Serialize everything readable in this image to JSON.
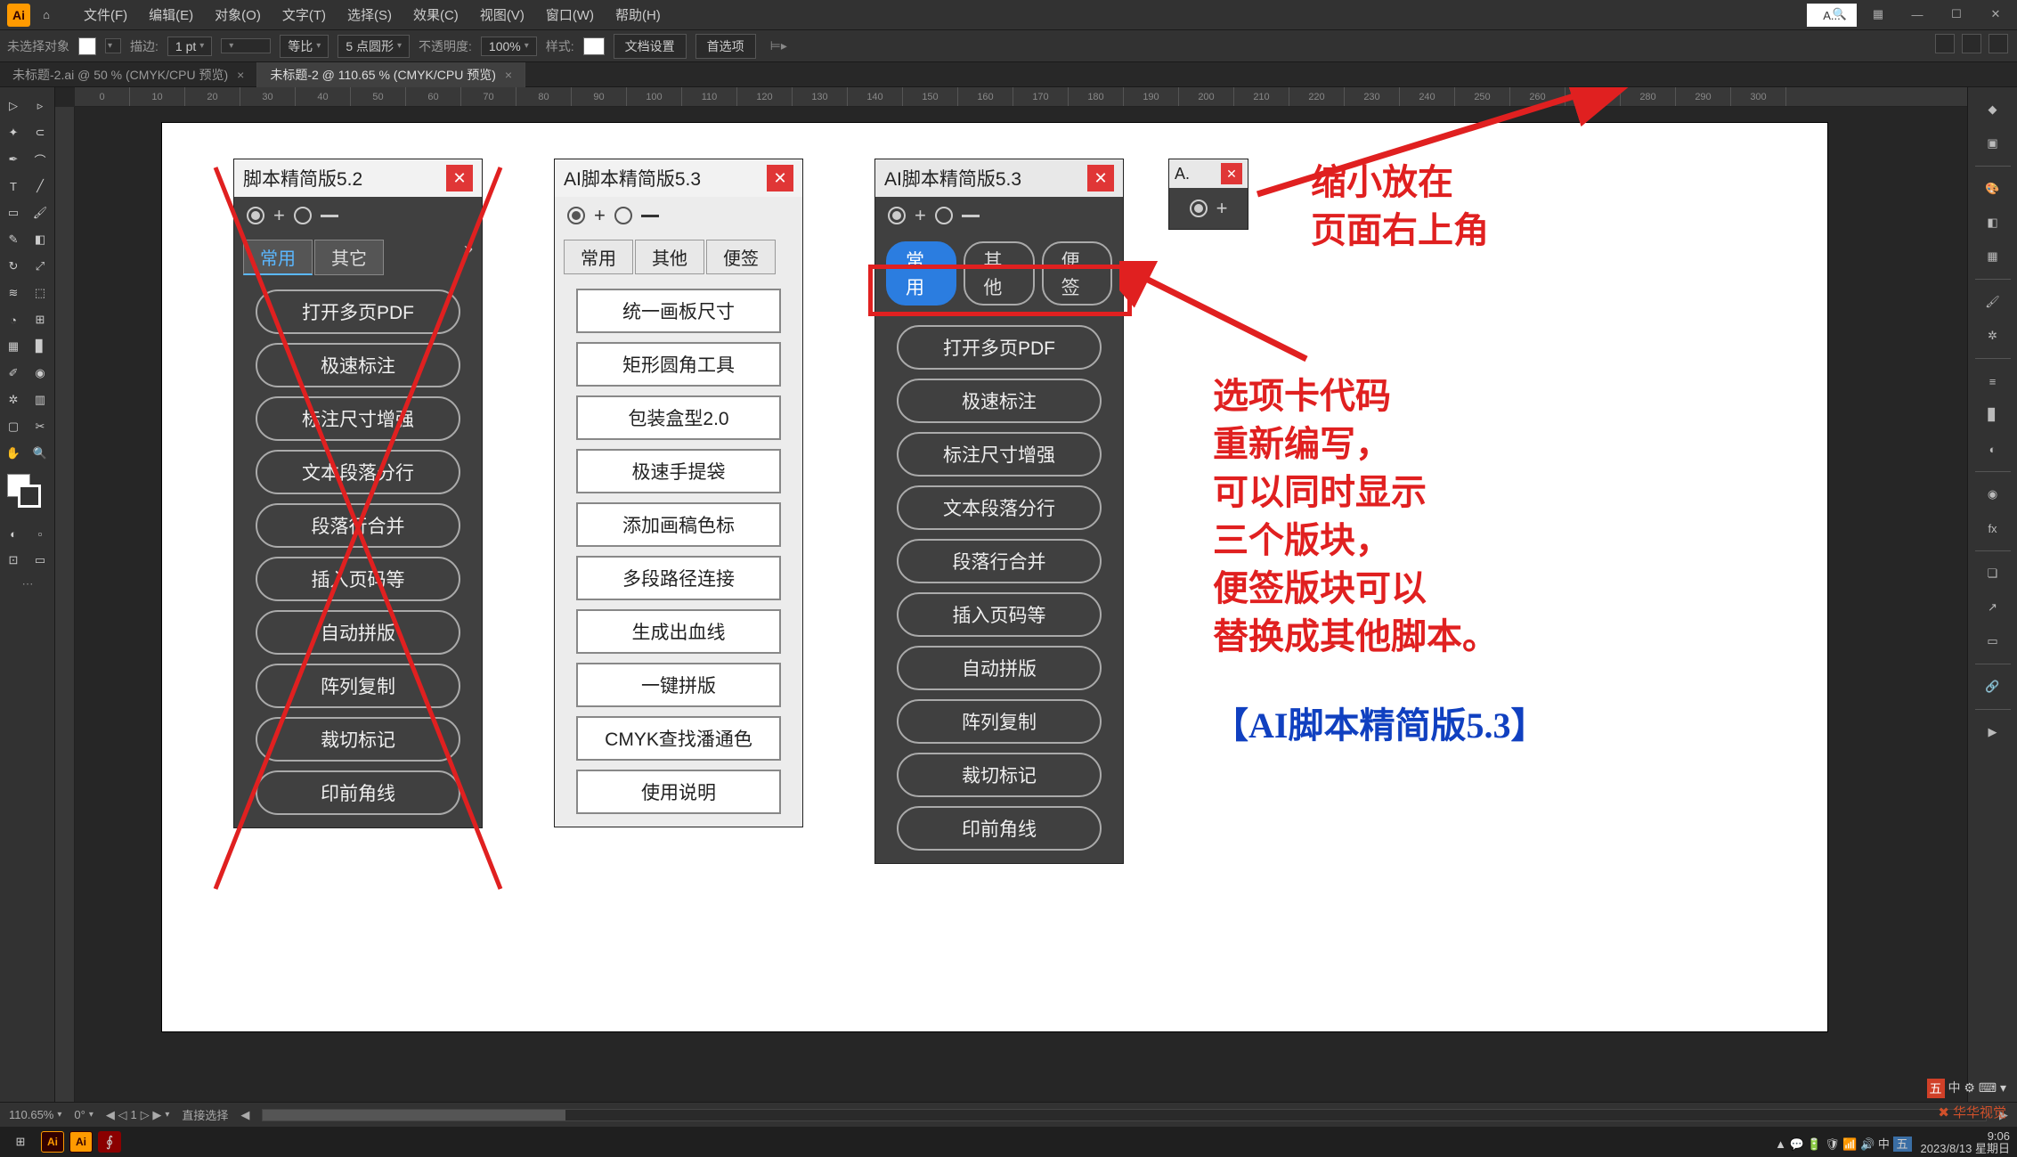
{
  "menubar": {
    "items": [
      "文件(F)",
      "编辑(E)",
      "对象(O)",
      "文字(T)",
      "选择(S)",
      "效果(C)",
      "视图(V)",
      "窗口(W)",
      "帮助(H)"
    ]
  },
  "mini_panel_label": "A...",
  "controlbar": {
    "no_selection": "未选择对象",
    "stroke_label": "描边:",
    "stroke_val": "1 pt",
    "uniform": "等比",
    "pt_round": "5 点圆形",
    "opacity_label": "不透明度:",
    "opacity_val": "100%",
    "style_label": "样式:",
    "doc_setup": "文档设置",
    "prefs": "首选项"
  },
  "tabs": {
    "t0": {
      "label": "未标题-2.ai @ 50 % (CMYK/CPU 预览)"
    },
    "t1": {
      "label": "未标题-2 @ 110.65 % (CMYK/CPU 预览)"
    }
  },
  "panels": {
    "p52": {
      "title": "脚本精简版5.2",
      "tabs": {
        "t0": "常用",
        "t1": "其它"
      },
      "buttons": [
        "打开多页PDF",
        "极速标注",
        "标注尺寸增强",
        "文本段落分行",
        "段落行合并",
        "插入页码等",
        "自动拼版",
        "阵列复制",
        "裁切标记",
        "印前角线"
      ]
    },
    "p53light": {
      "title": "AI脚本精简版5.3",
      "tabs": {
        "t0": "常用",
        "t1": "其他",
        "t2": "便签"
      },
      "buttons": [
        "统一画板尺寸",
        "矩形圆角工具",
        "包装盒型2.0",
        "极速手提袋",
        "添加画稿色标",
        "多段路径连接",
        "生成出血线",
        "一键拼版",
        "CMYK查找潘通色",
        "使用说明"
      ]
    },
    "p53dark": {
      "title": "AI脚本精简版5.3",
      "tabs": {
        "t0": "常用",
        "t1": "其他",
        "t2": "便签"
      },
      "buttons": [
        "打开多页PDF",
        "极速标注",
        "标注尺寸增强",
        "文本段落分行",
        "段落行合并",
        "插入页码等",
        "自动拼版",
        "阵列复制",
        "裁切标记",
        "印前角线"
      ]
    },
    "mini": {
      "title": "A."
    }
  },
  "annotations": {
    "a1": "缩小放在\n页面右上角",
    "a2": "选项卡代码\n重新编写，\n可以同时显示\n三个版块，\n便签版块可以\n替换成其他脚本。",
    "footer": "【AI脚本精简版5.3】"
  },
  "status": {
    "zoom": "110.65%",
    "rot": "0°",
    "artboard": "1",
    "tool": "直接选择"
  },
  "taskbar": {
    "time": "9:06",
    "date": "2023/8/13 星期日"
  },
  "ruler_ticks": [
    "0",
    "10",
    "20",
    "30",
    "40",
    "50",
    "60",
    "70",
    "80",
    "90",
    "100",
    "110",
    "120",
    "130",
    "140",
    "150",
    "160",
    "170",
    "180",
    "190",
    "200",
    "210",
    "220",
    "230",
    "240",
    "250",
    "260",
    "270",
    "280",
    "290",
    "300"
  ],
  "watermark": "华华视觉"
}
